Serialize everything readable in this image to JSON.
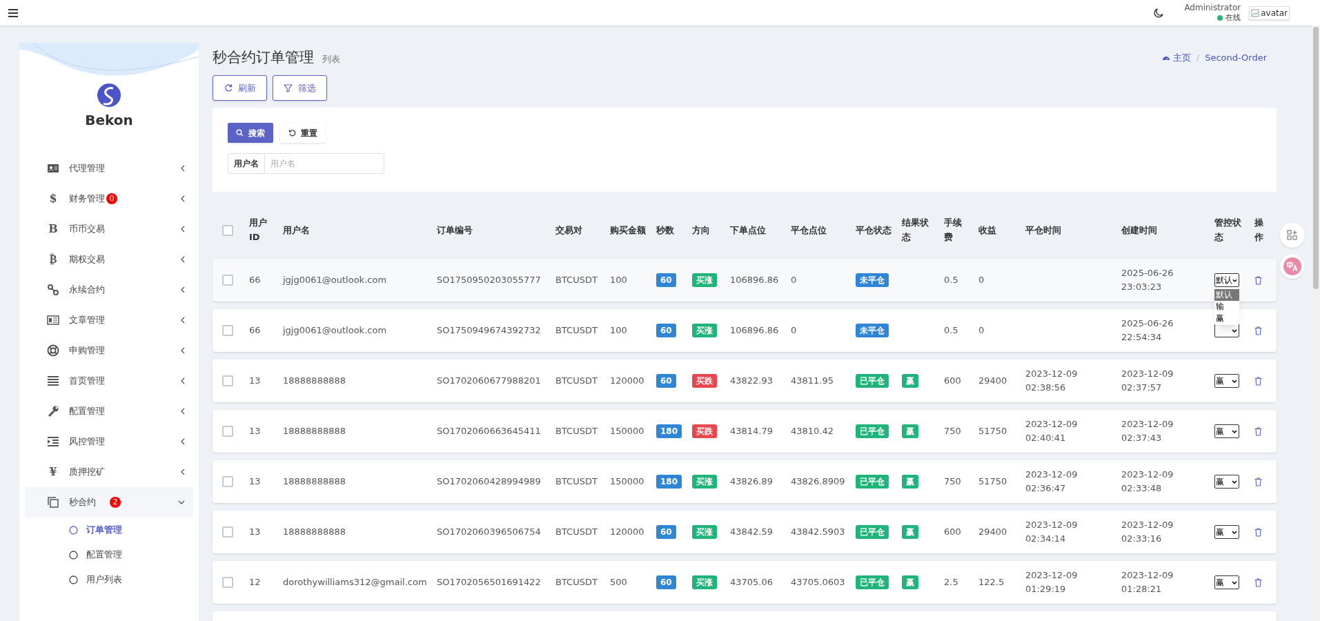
{
  "topbar": {
    "user_name": "Administrator",
    "status": "在线",
    "avatar_alt": "avatar"
  },
  "sidebar": {
    "brand": "Bekon",
    "items": [
      {
        "label": "代理管理",
        "kind": "idcard",
        "expanded": false
      },
      {
        "label": "财务管理",
        "kind": "glyph",
        "glyph": "$",
        "badge": "0",
        "expanded": false
      },
      {
        "label": "币币交易",
        "kind": "glyph",
        "glyph": "B",
        "expanded": false
      },
      {
        "label": "期权交易",
        "kind": "glyph",
        "glyph": "₿",
        "expanded": false
      },
      {
        "label": "永续合约",
        "kind": "link",
        "expanded": false
      },
      {
        "label": "文章管理",
        "kind": "news",
        "expanded": false
      },
      {
        "label": "申购管理",
        "kind": "lifebuoy",
        "expanded": false
      },
      {
        "label": "首页管理",
        "kind": "bars",
        "expanded": false
      },
      {
        "label": "配置管理",
        "kind": "wrench",
        "expanded": false
      },
      {
        "label": "风控管理",
        "kind": "indent",
        "expanded": false
      },
      {
        "label": "质押挖矿",
        "kind": "glyph",
        "glyph": "¥",
        "expanded": false
      },
      {
        "label": "秒合约",
        "kind": "copy",
        "badge": "2",
        "expanded": true,
        "children": [
          {
            "label": "订单管理",
            "selected": true
          },
          {
            "label": "配置管理",
            "selected": false
          },
          {
            "label": "用户列表",
            "selected": false
          }
        ]
      }
    ]
  },
  "page": {
    "title": "秒合约订单管理",
    "subtitle": "列表",
    "breadcrumb": [
      {
        "label": "主页"
      },
      {
        "label": "Second-Order"
      }
    ],
    "breadcrumb_separator": "/",
    "buttons": [
      {
        "label": "刷新",
        "kind": "refresh"
      },
      {
        "label": "筛选",
        "kind": "filter"
      }
    ]
  },
  "search": {
    "buttons": [
      {
        "label": "搜索",
        "kind": "primary"
      },
      {
        "label": "重置",
        "kind": "default"
      }
    ],
    "field_label": "用户名",
    "placeholder": "用户名"
  },
  "table": {
    "select_all_checked": false,
    "columns": [
      "用户ID",
      "用户名",
      "订单编号",
      "交易对",
      "购买金额",
      "秒数",
      "方向",
      "下单点位",
      "平仓点位",
      "平仓状态",
      "结果状态",
      "手续费",
      "收益",
      "平仓时间",
      "创建时间",
      "管控状态",
      "操作"
    ],
    "rows": [
      {
        "checked": false,
        "user_id": "66",
        "username": "jgjg0061@outlook.com",
        "order_no": "SO1750950203055777",
        "pair": "BTCUSDT",
        "amount": "100",
        "seconds": "60",
        "direction": {
          "text": "买涨",
          "kind": "up"
        },
        "open_price": "106896.86",
        "close_price": "0",
        "close_status": {
          "text": "未平仓",
          "kind": "open"
        },
        "fee": "0.5",
        "profit": "0",
        "create_time": "2025-06-26 23:03:23",
        "control": "默认",
        "dropdown": [
          {
            "label": "默认",
            "selected": true
          },
          {
            "label": "输",
            "selected": false
          },
          {
            "label": "赢",
            "selected": false
          }
        ]
      },
      {
        "checked": false,
        "user_id": "66",
        "username": "jgjg0061@outlook.com",
        "order_no": "SO1750949674392732",
        "pair": "BTCUSDT",
        "amount": "100",
        "seconds": "60",
        "direction": {
          "text": "买涨",
          "kind": "up"
        },
        "open_price": "106896.86",
        "close_price": "0",
        "close_status": {
          "text": "未平仓",
          "kind": "open"
        },
        "fee": "0.5",
        "profit": "0",
        "create_time": "2025-06-26 22:54:34"
      },
      {
        "checked": false,
        "user_id": "13",
        "username": "18888888888",
        "order_no": "SO1702060677988201",
        "pair": "BTCUSDT",
        "amount": "120000",
        "seconds": "60",
        "direction": {
          "text": "买跌",
          "kind": "down"
        },
        "open_price": "43822.93",
        "close_price": "43811.95",
        "close_status": {
          "text": "已平仓",
          "kind": "closed"
        },
        "result": "赢",
        "fee": "600",
        "profit": "29400",
        "close_time": "2023-12-09 02:38:56",
        "create_time": "2023-12-09 02:37:57",
        "control": "赢"
      },
      {
        "checked": false,
        "user_id": "13",
        "username": "18888888888",
        "order_no": "SO1702060663645411",
        "pair": "BTCUSDT",
        "amount": "150000",
        "seconds": "180",
        "direction": {
          "text": "买跌",
          "kind": "down"
        },
        "open_price": "43814.79",
        "close_price": "43810.42",
        "close_status": {
          "text": "已平仓",
          "kind": "closed"
        },
        "result": "赢",
        "fee": "750",
        "profit": "51750",
        "close_time": "2023-12-09 02:40:41",
        "create_time": "2023-12-09 02:37:43",
        "control": "赢"
      },
      {
        "checked": false,
        "user_id": "13",
        "username": "18888888888",
        "order_no": "SO1702060428994989",
        "pair": "BTCUSDT",
        "amount": "150000",
        "seconds": "180",
        "direction": {
          "text": "买涨",
          "kind": "up"
        },
        "open_price": "43826.89",
        "close_price": "43826.8909",
        "close_status": {
          "text": "已平仓",
          "kind": "closed"
        },
        "result": "赢",
        "fee": "750",
        "profit": "51750",
        "close_time": "2023-12-09 02:36:47",
        "create_time": "2023-12-09 02:33:48",
        "control": "赢"
      },
      {
        "checked": false,
        "user_id": "13",
        "username": "18888888888",
        "order_no": "SO1702060396506754",
        "pair": "BTCUSDT",
        "amount": "120000",
        "seconds": "60",
        "direction": {
          "text": "买涨",
          "kind": "up"
        },
        "open_price": "43842.59",
        "close_price": "43842.5903",
        "close_status": {
          "text": "已平仓",
          "kind": "closed"
        },
        "result": "赢",
        "fee": "600",
        "profit": "29400",
        "close_time": "2023-12-09 02:34:14",
        "create_time": "2023-12-09 02:33:16",
        "control": "赢"
      },
      {
        "checked": false,
        "user_id": "12",
        "username": "dorothywilliams312@gmail.com",
        "order_no": "SO1702056501691422",
        "pair": "BTCUSDT",
        "amount": "500",
        "seconds": "60",
        "direction": {
          "text": "买涨",
          "kind": "up"
        },
        "open_price": "43705.06",
        "close_price": "43705.0603",
        "close_status": {
          "text": "已平仓",
          "kind": "closed"
        },
        "result": "赢",
        "fee": "2.5",
        "profit": "122.5",
        "close_time": "2023-12-09 01:29:19",
        "create_time": "2023-12-09 01:28:21",
        "control": "赢"
      }
    ]
  }
}
